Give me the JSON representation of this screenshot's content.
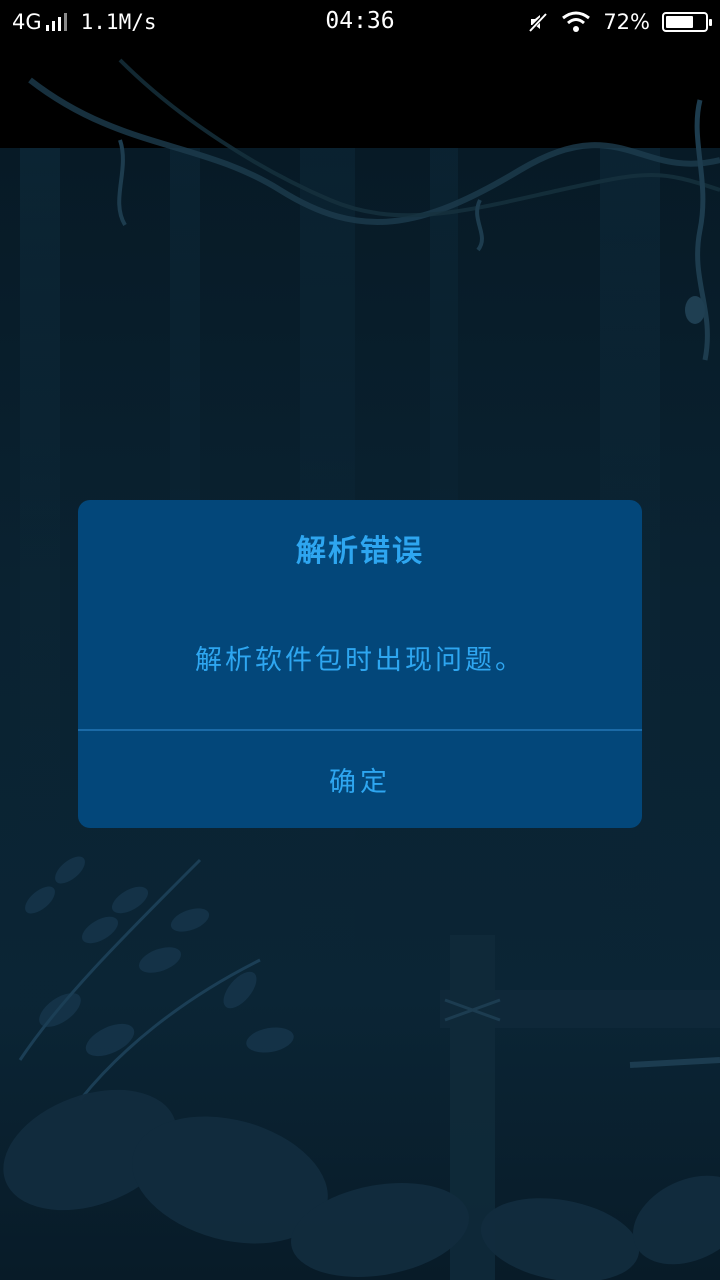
{
  "status_bar": {
    "network": "4G",
    "speed": "1.1M/s",
    "time": "04:36",
    "battery_percent": "72%",
    "battery_level": 0.72,
    "icons": [
      "signal-icon",
      "mute-icon",
      "wifi-icon",
      "battery-icon"
    ]
  },
  "dialog": {
    "title": "解析错误",
    "message": "解析软件包时出现问题。",
    "ok_label": "确定"
  },
  "colors": {
    "dialog_bg": "#03477a",
    "dialog_text": "#2ea6f0",
    "divider": "#1b6aa7",
    "background": "#0a2231"
  }
}
